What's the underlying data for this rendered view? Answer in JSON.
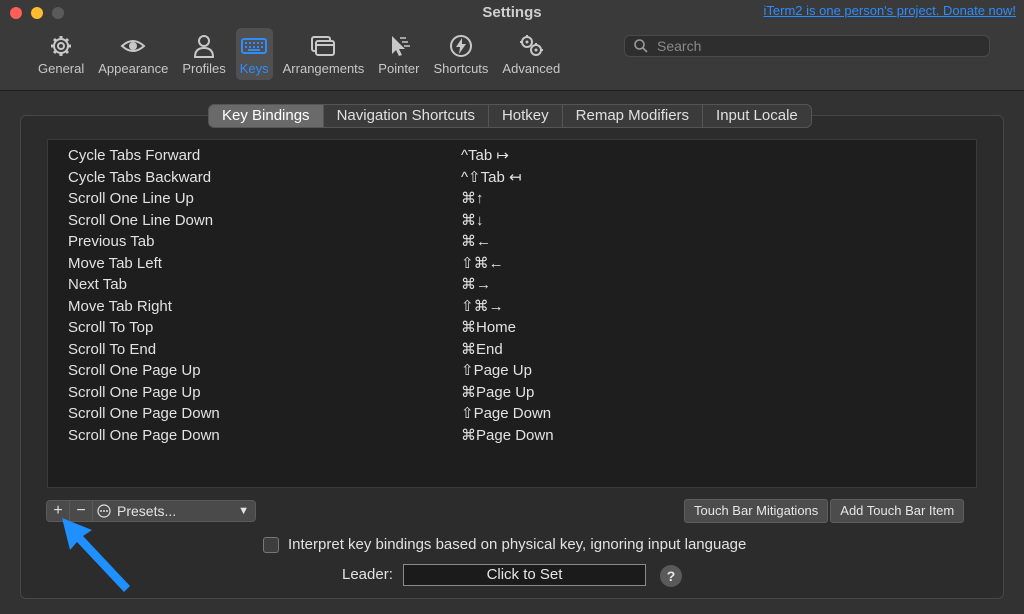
{
  "window": {
    "title": "Settings",
    "donate_link": "iTerm2 is one person's project. Donate now!"
  },
  "toolbar": {
    "items": [
      {
        "label": "General",
        "icon": "gear-icon"
      },
      {
        "label": "Appearance",
        "icon": "eye-icon"
      },
      {
        "label": "Profiles",
        "icon": "person-icon"
      },
      {
        "label": "Keys",
        "icon": "keyboard-icon",
        "active": true
      },
      {
        "label": "Arrangements",
        "icon": "windows-icon"
      },
      {
        "label": "Pointer",
        "icon": "cursor-icon"
      },
      {
        "label": "Shortcuts",
        "icon": "bolt-icon"
      },
      {
        "label": "Advanced",
        "icon": "gears-icon"
      }
    ],
    "search_placeholder": "Search"
  },
  "tabs": [
    {
      "label": "Key Bindings",
      "active": true
    },
    {
      "label": "Navigation Shortcuts"
    },
    {
      "label": "Hotkey"
    },
    {
      "label": "Remap Modifiers"
    },
    {
      "label": "Input Locale"
    }
  ],
  "bindings": [
    {
      "action": "Cycle Tabs Forward",
      "combo": "^Tab ↦"
    },
    {
      "action": "Cycle Tabs Backward",
      "combo": "^⇧Tab ↤"
    },
    {
      "action": "Scroll One Line Up",
      "combo": "⌘↑"
    },
    {
      "action": "Scroll One Line Down",
      "combo": "⌘↓"
    },
    {
      "action": "Previous Tab",
      "combo": "⌘←"
    },
    {
      "action": "Move Tab Left",
      "combo": "⇧⌘←"
    },
    {
      "action": "Next Tab",
      "combo": "⌘→"
    },
    {
      "action": "Move Tab Right",
      "combo": "⇧⌘→"
    },
    {
      "action": "Scroll To Top",
      "combo": "⌘Home"
    },
    {
      "action": "Scroll To End",
      "combo": "⌘End"
    },
    {
      "action": "Scroll One Page Up",
      "combo": "⇧Page Up"
    },
    {
      "action": "Scroll One Page Up",
      "combo": "⌘Page Up"
    },
    {
      "action": "Scroll One Page Down",
      "combo": "⇧Page Down"
    },
    {
      "action": "Scroll One Page Down",
      "combo": "⌘Page Down"
    }
  ],
  "controls": {
    "add_label": "+",
    "remove_label": "−",
    "presets_label": "Presets...",
    "touch_bar_mitigations": "Touch Bar Mitigations",
    "add_touch_bar_item": "Add Touch Bar Item",
    "physical_key_checkbox": "Interpret key bindings based on physical key, ignoring input language",
    "leader_label": "Leader:",
    "leader_value": "Click to Set",
    "help_label": "?"
  },
  "colors": {
    "accent": "#2f8cff",
    "annotation_arrow": "#1e90ff"
  }
}
